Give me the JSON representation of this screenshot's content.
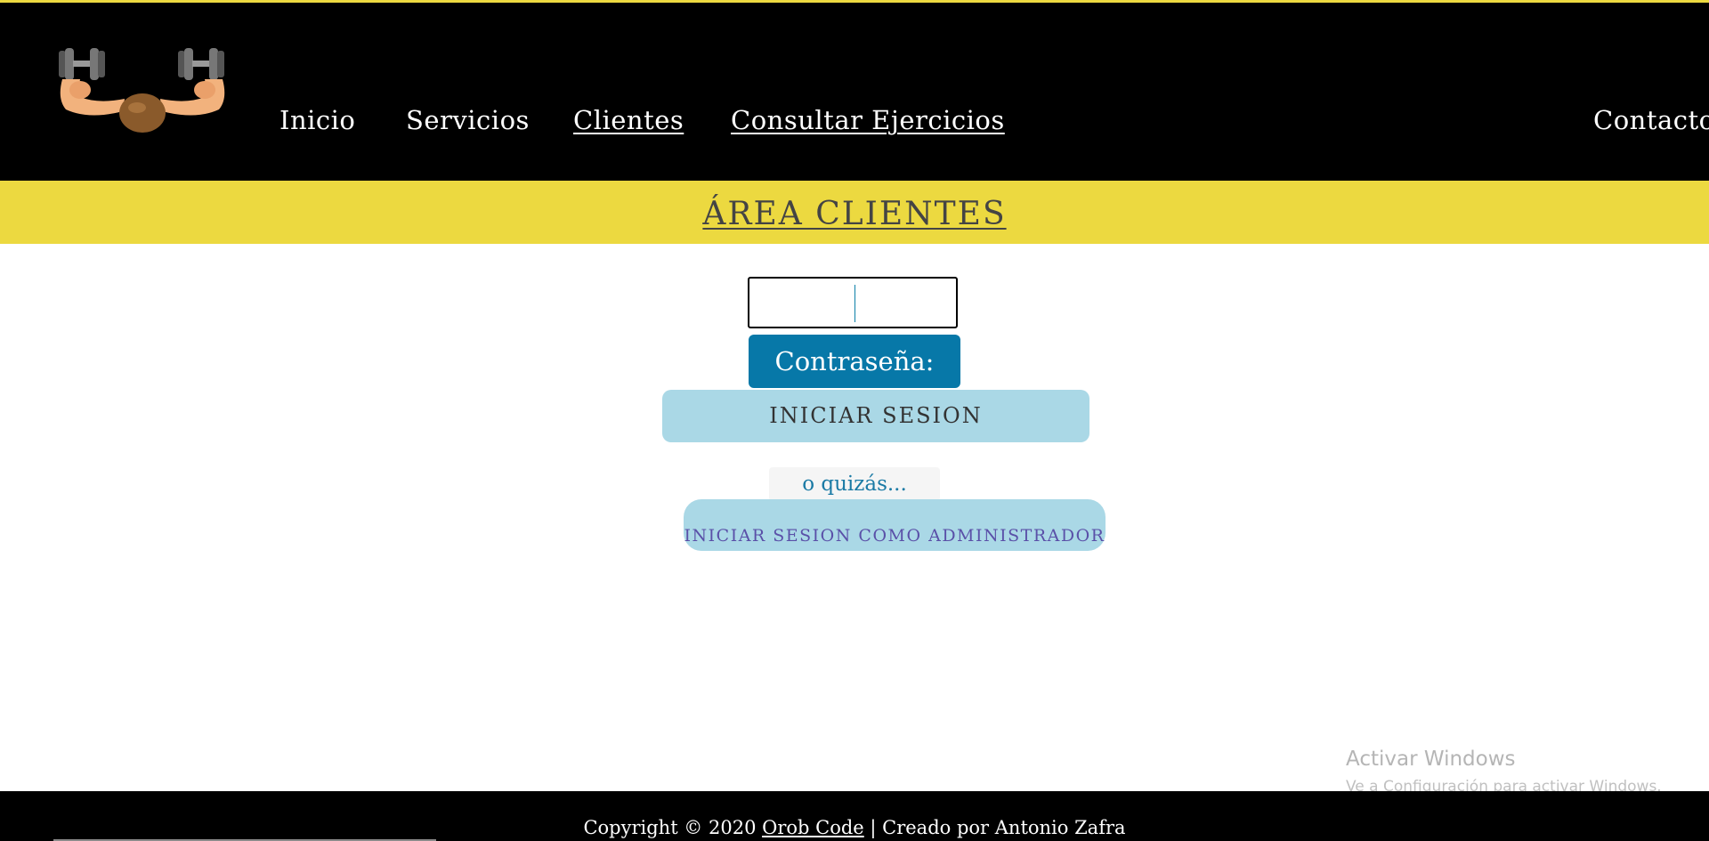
{
  "nav": {
    "items": [
      {
        "label": "Inicio"
      },
      {
        "label": "Servicios"
      },
      {
        "label": "Clientes"
      },
      {
        "label": "Consultar Ejercicios"
      }
    ],
    "contact": "Contacto"
  },
  "banner": {
    "title": "ÁREA CLIENTES"
  },
  "login": {
    "password_value": "",
    "password_label": "Contraseña:",
    "login_button": "INICIAR SESION",
    "alt_text": "o quizás...",
    "admin_button": "INICIAR SESION COMO ADMINISTRADOR"
  },
  "watermark": {
    "title": "Activar Windows",
    "subtitle": "Ve a Configuración para activar Windows."
  },
  "footer": {
    "prefix": "Copyright © 2020 ",
    "company": "Orob Code",
    "suffix": " | Creado por Antonio Zafra"
  },
  "colors": {
    "accent_yellow": "#ecd940",
    "primary_blue": "#0778a8",
    "light_blue": "#aad8e6"
  },
  "icons": {
    "logo": "muscle-arms-dumbbells-icon"
  }
}
